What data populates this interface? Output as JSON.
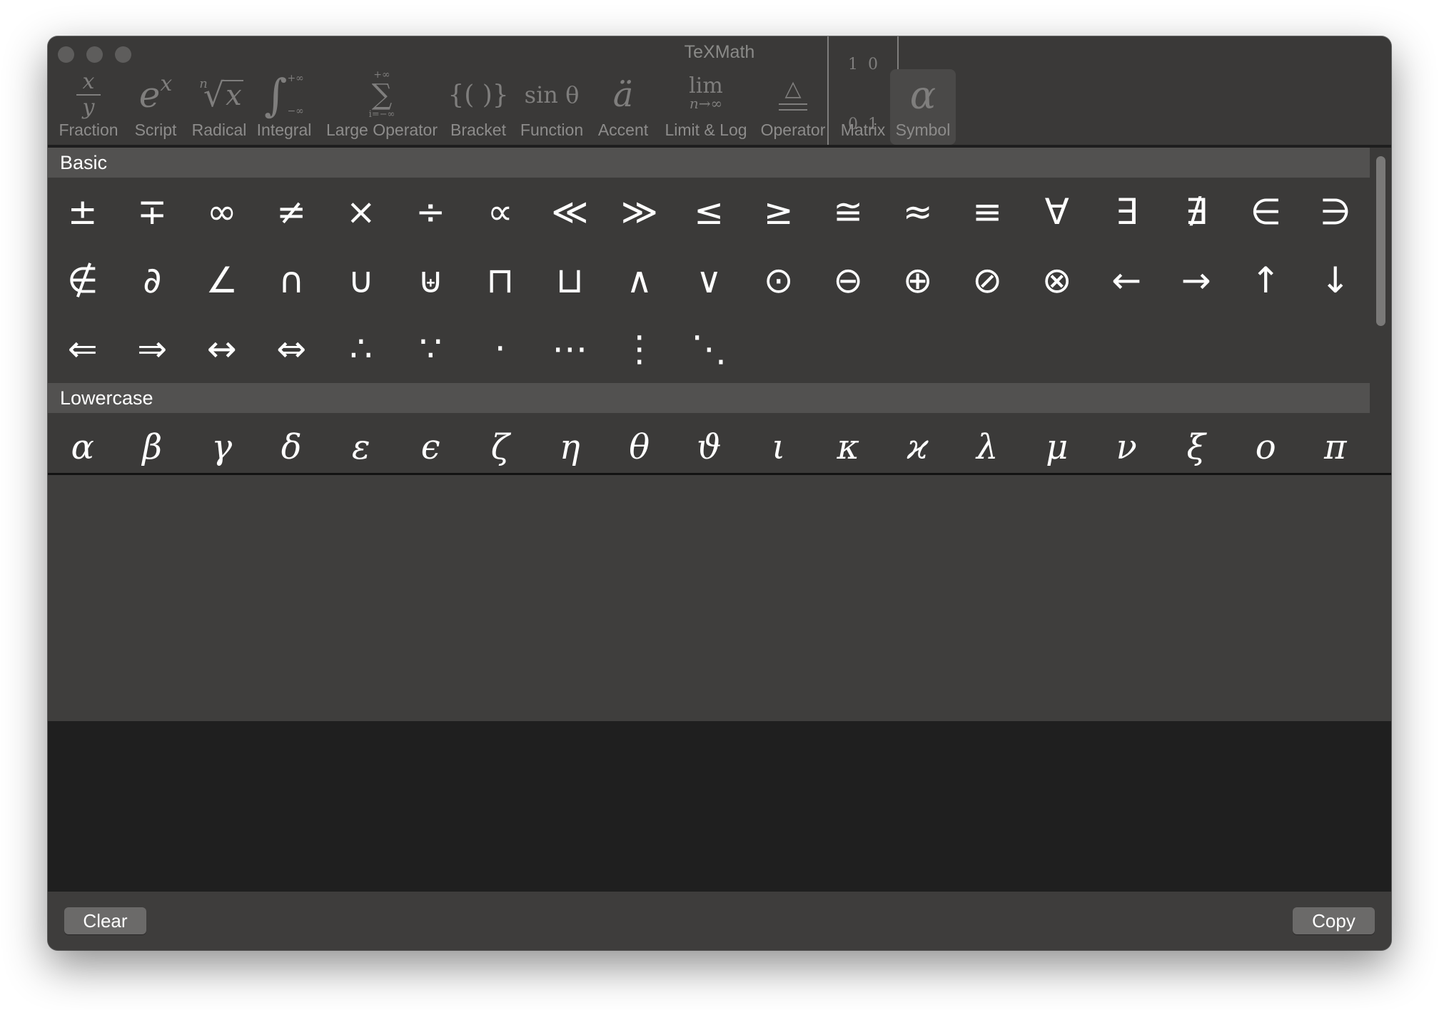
{
  "window": {
    "title": "TeXMath"
  },
  "toolbar": {
    "tools": [
      {
        "name": "fraction",
        "label": "Fraction"
      },
      {
        "name": "script",
        "label": "Script"
      },
      {
        "name": "radical",
        "label": "Radical"
      },
      {
        "name": "integral",
        "label": "Integral"
      },
      {
        "name": "large-operator",
        "label": "Large Operator"
      },
      {
        "name": "bracket",
        "label": "Bracket"
      },
      {
        "name": "function",
        "label": "Function"
      },
      {
        "name": "accent",
        "label": "Accent"
      },
      {
        "name": "limit-log",
        "label": "Limit & Log"
      },
      {
        "name": "operator",
        "label": "Operator"
      },
      {
        "name": "matrix",
        "label": "Matrix"
      },
      {
        "name": "symbol",
        "label": "Symbol"
      }
    ],
    "selected": "Symbol",
    "icons": {
      "fraction_num": "x",
      "fraction_den": "y",
      "script_base": "e",
      "script_exp": "x",
      "radical_index": "n",
      "radical_radicand": "x",
      "integral_upper": "+∞",
      "integral_lower": "−∞",
      "sum_upper": "+∞",
      "sum_lower": "i=−∞",
      "bracket": "{( )}",
      "function": "sin θ",
      "accent": "ä",
      "limit_top": "lim",
      "limit_bottom": "n→∞",
      "matrix_row1": "1  0",
      "matrix_row2": "0  1",
      "symbol": "α"
    }
  },
  "symbols": {
    "sections": [
      {
        "title": "Basic",
        "symbols": [
          "±",
          "∓",
          "∞",
          "≠",
          "×",
          "÷",
          "∝",
          "≪",
          "≫",
          "≤",
          "≥",
          "≅",
          "≈",
          "≡",
          "∀",
          "∃",
          "∄",
          "∈",
          "∋",
          "∉",
          "∂",
          "∠",
          "∩",
          "∪",
          "⊎",
          "⊓",
          "⊔",
          "∧",
          "∨",
          "⊙",
          "⊖",
          "⊕",
          "⊘",
          "⊗",
          "←",
          "→",
          "↑",
          "↓",
          "⇐",
          "⇒",
          "↔",
          "⇔",
          "∴",
          "∵",
          "·",
          "⋯",
          "⋮",
          "⋱"
        ]
      },
      {
        "title": "Lowercase",
        "symbols": [
          "α",
          "β",
          "γ",
          "δ",
          "ε",
          "ϵ",
          "ζ",
          "η",
          "θ",
          "ϑ",
          "ι",
          "κ",
          "ϰ",
          "λ",
          "μ",
          "ν",
          "ξ",
          "ο",
          "π"
        ]
      }
    ]
  },
  "editor": {
    "text": ""
  },
  "buttons": {
    "clear": "Clear",
    "copy": "Copy"
  },
  "colors": {
    "window_bg": "#3e3d3c",
    "section_header_bg": "#525150",
    "preview_bg": "#1f1f1f",
    "button_bg": "#6b6a69"
  }
}
